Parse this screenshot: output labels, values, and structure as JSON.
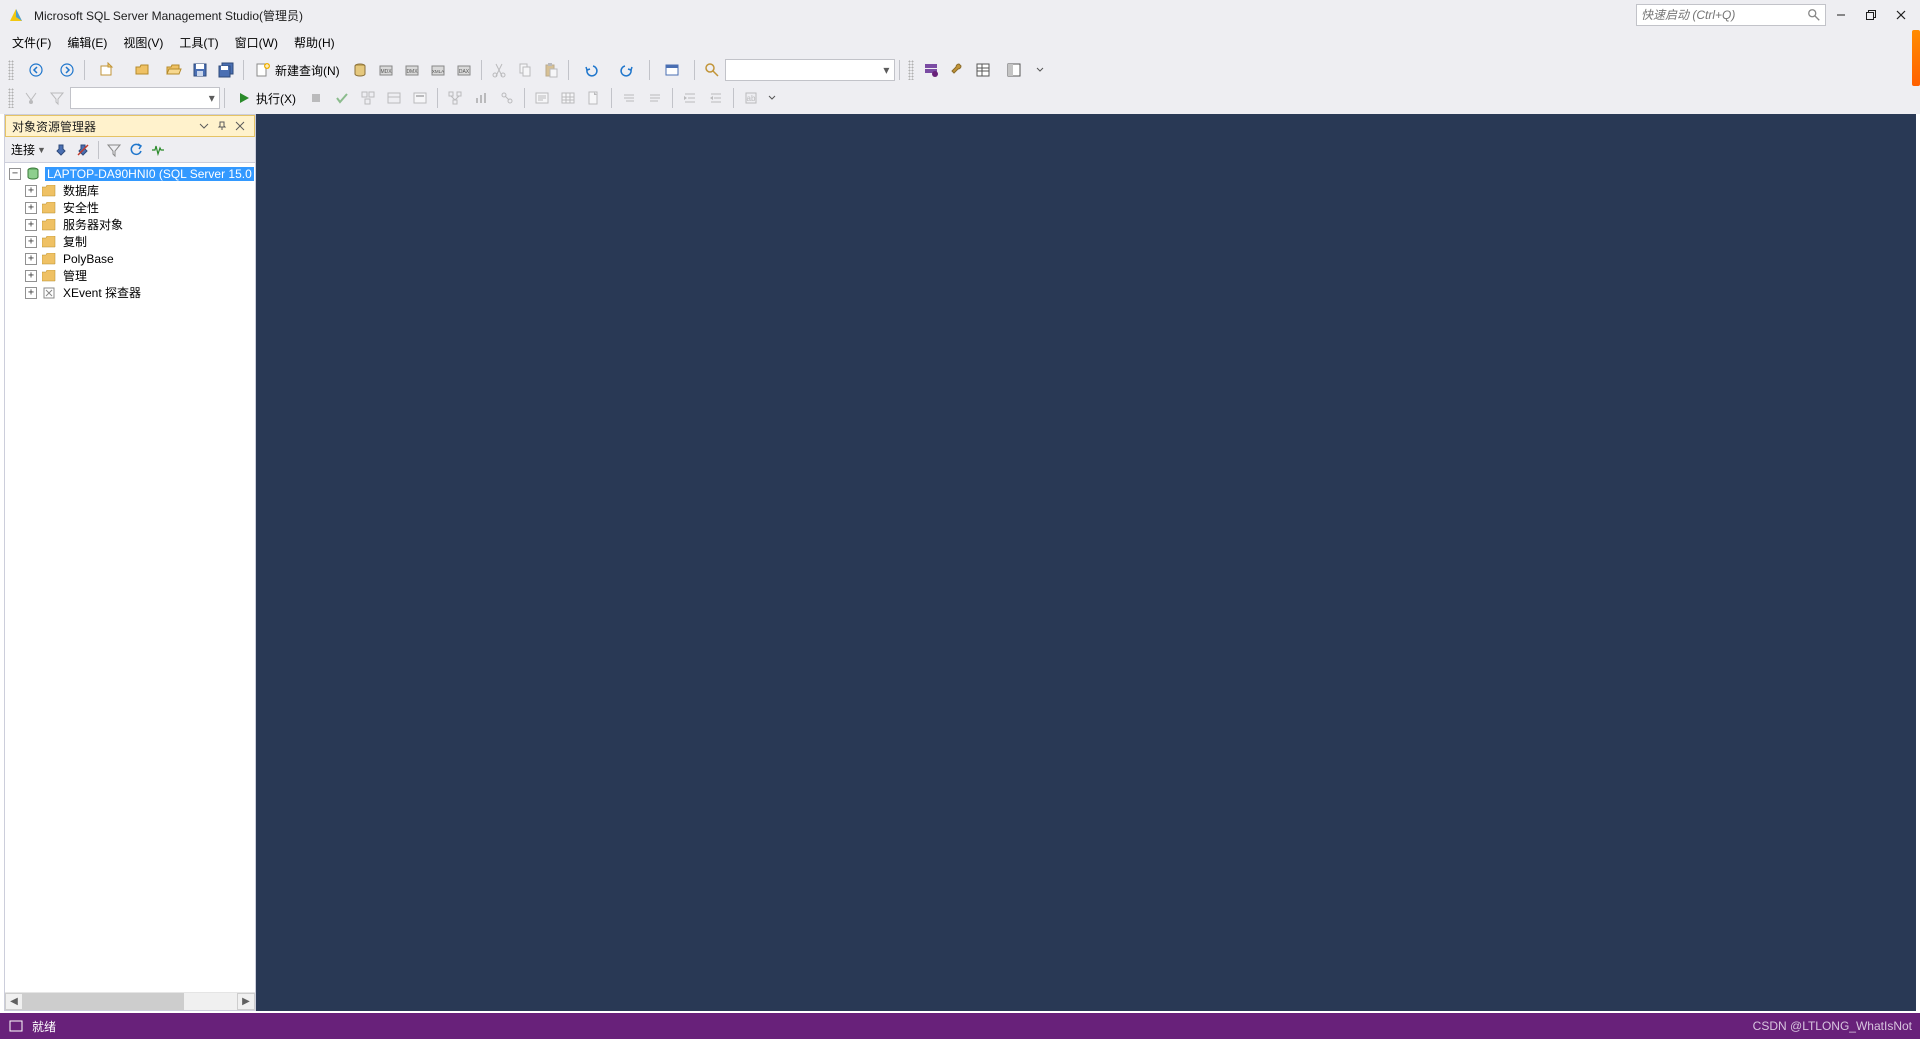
{
  "titlebar": {
    "app_title": "Microsoft SQL Server Management Studio(管理员)",
    "quick_launch_placeholder": "快速启动 (Ctrl+Q)"
  },
  "menu": {
    "file": "文件(F)",
    "edit": "编辑(E)",
    "view": "视图(V)",
    "tools": "工具(T)",
    "window": "窗口(W)",
    "help": "帮助(H)"
  },
  "toolbar": {
    "new_query_label": "新建查询(N)",
    "execute_label": "执行(X)"
  },
  "panel": {
    "title": "对象资源管理器",
    "connect_label": "连接"
  },
  "tree": {
    "server": "LAPTOP-DA90HNI0 (SQL Server 15.0",
    "items": [
      "数据库",
      "安全性",
      "服务器对象",
      "复制",
      "PolyBase",
      "管理",
      "XEvent 探查器"
    ]
  },
  "statusbar": {
    "ready": "就绪",
    "watermark": "CSDN @LTLONG_WhatIsNot"
  }
}
